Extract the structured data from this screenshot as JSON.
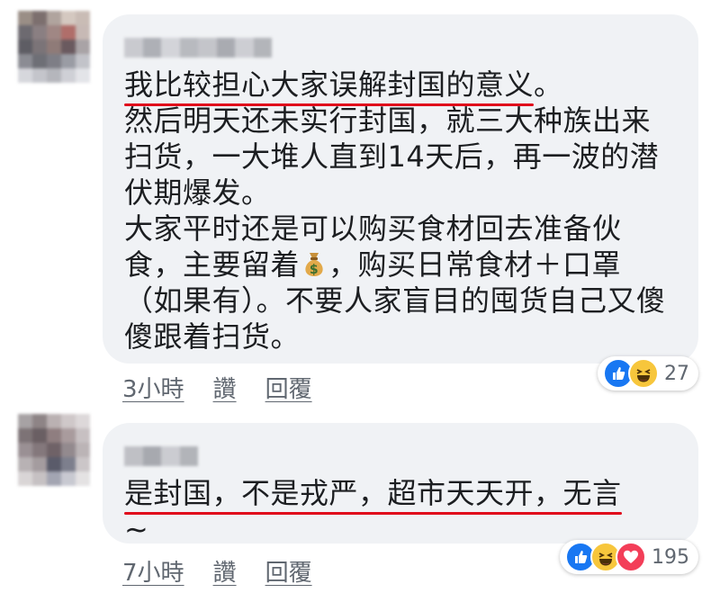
{
  "comments": [
    {
      "author": "",
      "text_underlined": "我比较担心大家误解封国的意义",
      "text_after_underline": "。\n然后明天还未实行封国，就三大种族出来扫货，一大堆人直到14天后，再一波的潜伏期爆发。\n大家平时还是可以购买食材回去准备伙食，主要留着",
      "emoji_icon": "money-bag-icon",
      "text_after_emoji": "，购买日常食材＋口罩（如果有）。不要人家盲目的囤货自己又傻傻跟着扫货。",
      "time": "3小時",
      "like_label": "讚",
      "reply_label": "回覆",
      "reactions": [
        "like-icon",
        "haha-icon"
      ],
      "reaction_count": "27"
    },
    {
      "author": "",
      "text_underlined": "是封国，不是戎严，超市天天开，无言",
      "text_after_underline": "\n~",
      "time": "7小時",
      "like_label": "讚",
      "reply_label": "回覆",
      "reactions": [
        "like-icon",
        "haha-icon",
        "love-icon"
      ],
      "reaction_count": "195"
    }
  ],
  "colors": {
    "bubble_bg": "#f0f2f5",
    "underline_red": "#e0091b",
    "meta_gray": "#606770",
    "like_blue": "#1877f2",
    "haha_yellow": "#f7c63c",
    "love_red": "#f33e58"
  }
}
